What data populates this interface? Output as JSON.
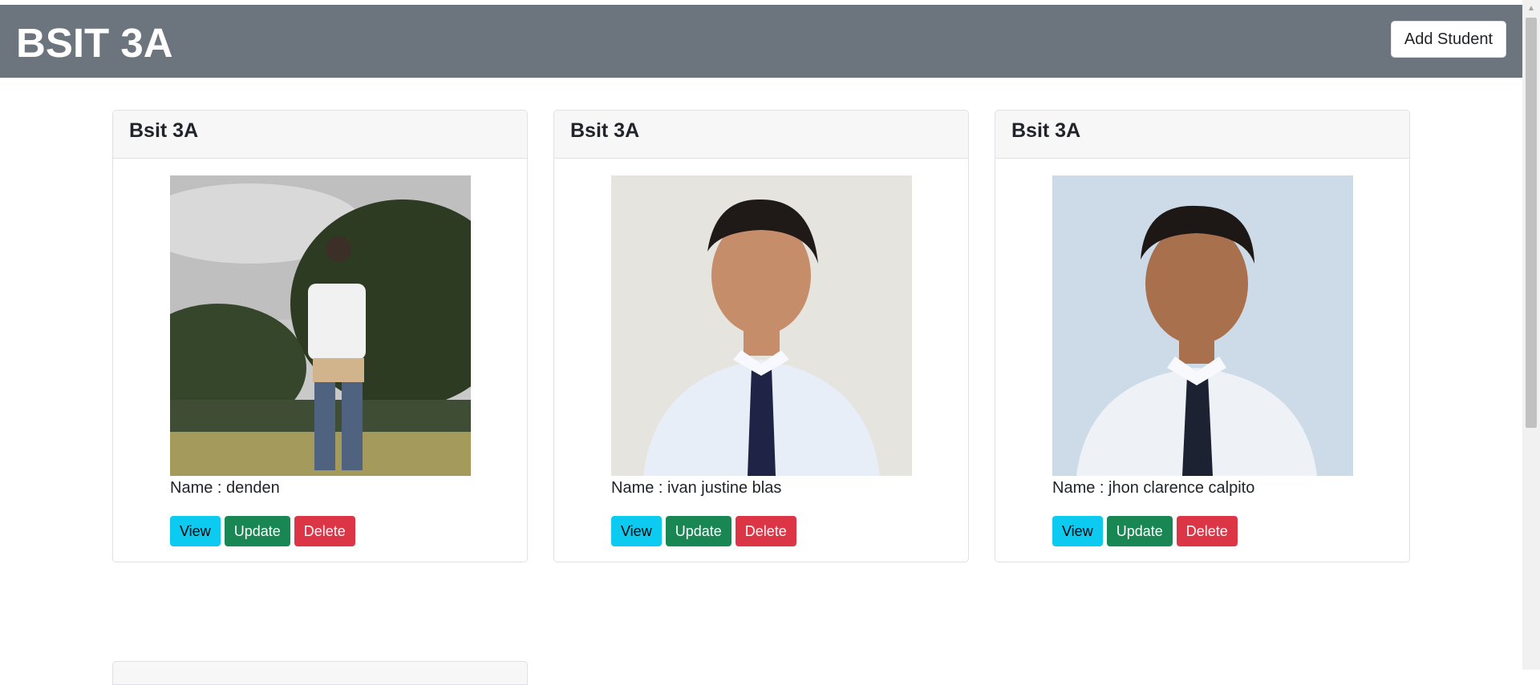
{
  "header": {
    "title": "BSIT 3A",
    "add_button_label": "Add Student"
  },
  "colors": {
    "header_bg": "#6c757d",
    "view_button": "#0dcaf0",
    "update_button": "#198754",
    "delete_button": "#dc3545"
  },
  "students": [
    {
      "section": "Bsit 3A",
      "name": "Name : denden",
      "photo": "student-photo-outdoor-field",
      "actions": {
        "view": "View",
        "update": "Update",
        "delete": "Delete"
      }
    },
    {
      "section": "Bsit 3A",
      "name": "Name : ivan justine blas",
      "photo": "student-photo-formal-portrait",
      "actions": {
        "view": "View",
        "update": "Update",
        "delete": "Delete"
      }
    },
    {
      "section": "Bsit 3A",
      "name": "Name : jhon clarence calpito",
      "photo": "student-photo-formal-portrait",
      "actions": {
        "view": "View",
        "update": "Update",
        "delete": "Delete"
      }
    }
  ]
}
